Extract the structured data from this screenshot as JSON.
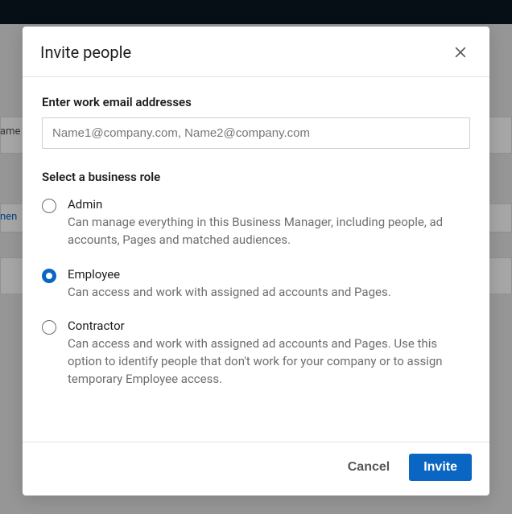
{
  "modal": {
    "title": "Invite people",
    "email_label": "Enter work email addresses",
    "email_placeholder": "Name1@company.com, Name2@company.com",
    "role_label": "Select a business role",
    "roles": [
      {
        "label": "Admin",
        "description": "Can manage everything in this Business Manager, including people, ad accounts, Pages and matched audiences.",
        "selected": false
      },
      {
        "label": "Employee",
        "description": "Can access and work with assigned ad accounts and Pages.",
        "selected": true
      },
      {
        "label": "Contractor",
        "description": "Can access and work with assigned ad accounts and Pages. Use this option to identify people that don't work for your company or to assign temporary Employee access.",
        "selected": false
      }
    ],
    "cancel_label": "Cancel",
    "submit_label": "Invite"
  },
  "background": {
    "label_a": "ame",
    "label_b": "nen"
  }
}
